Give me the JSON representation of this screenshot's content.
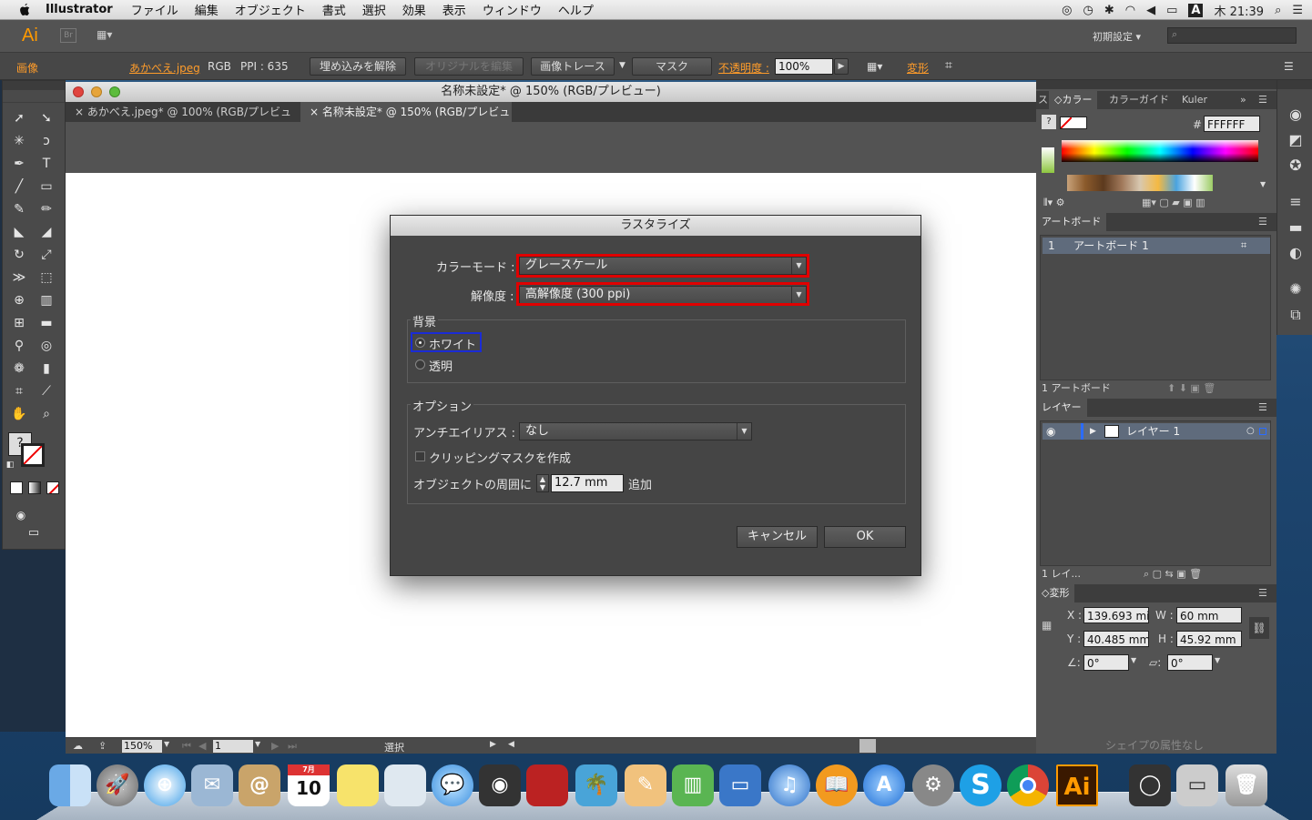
{
  "menubar": {
    "app_name": "Illustrator",
    "items": [
      "ファイル",
      "編集",
      "オブジェクト",
      "書式",
      "選択",
      "効果",
      "表示",
      "ウィンドウ",
      "ヘルプ"
    ],
    "clock": "木 21:39",
    "input_indicator": "A"
  },
  "appbar": {
    "logo": "Ai",
    "bridge": "Br",
    "workspace": "初期設定",
    "search_placeholder": ""
  },
  "control": {
    "mode": "画像",
    "filename": "あかべえ.jpeg",
    "colorspace": "RGB",
    "ppi": "PPI : 635",
    "unembed": "埋め込みを解除",
    "edit_original": "オリジナルを編集",
    "image_trace": "画像トレース",
    "mask": "マスク",
    "opacity_label": "不透明度 :",
    "opacity_value": "100%",
    "transform": "変形"
  },
  "document": {
    "title": "名称未設定* @ 150% (RGB/プレビュー)",
    "tabs": [
      {
        "label": "あかべえ.jpeg* @ 100% (RGB/プレビュー)",
        "active": false
      },
      {
        "label": "名称未設定* @ 150% (RGB/プレビュー)",
        "active": true
      }
    ],
    "zoom": "150%",
    "page": "1",
    "status_tool": "選択"
  },
  "dialog": {
    "title": "ラスタライズ",
    "color_mode_label": "カラーモード :",
    "color_mode_value": "グレースケール",
    "resolution_label": "解像度 :",
    "resolution_value": "高解像度 (300 ppi)",
    "background_group": "背景",
    "bg_white": "ホワイト",
    "bg_transparent": "透明",
    "bg_selected": "white",
    "options_group": "オプション",
    "antialias_label": "アンチエイリアス :",
    "antialias_value": "なし",
    "clipping_mask": "クリッピングマスクを作成",
    "clipping_checked": false,
    "padding_label": "オブジェクトの周囲に",
    "padding_value": "12.7 mm",
    "padding_suffix": "追加",
    "cancel": "キャンセル",
    "ok": "OK",
    "highlight_red": "#e00000",
    "highlight_blue": "#1a2bd6"
  },
  "color_panel": {
    "tabs": [
      "ス",
      "カラー",
      "カラーガイド",
      "Kuler"
    ],
    "hex_label": "#",
    "hex_value": "FFFFFF"
  },
  "artboard_panel": {
    "title": "アートボード",
    "rows": [
      {
        "num": "1",
        "name": "アートボード 1"
      }
    ],
    "footer": "1 アートボード"
  },
  "layers_panel": {
    "title": "レイヤー",
    "rows": [
      {
        "name": "レイヤー 1"
      }
    ],
    "footer": "1 レイ..."
  },
  "transform_panel": {
    "title": "変形",
    "x_label": "X :",
    "x": "139.693 mi",
    "y_label": "Y :",
    "y": "40.485 mm",
    "w_label": "W :",
    "w": "60 mm",
    "h_label": "H :",
    "h": "45.92 mm",
    "rotate": "0°",
    "shear": "0°",
    "shape_note": "シェイプの属性なし"
  },
  "dock": {
    "items": [
      "finder",
      "launchpad",
      "safari",
      "mail",
      "contacts",
      "calendar",
      "notes",
      "preview",
      "messages",
      "facetime",
      "photo-booth",
      "iphoto",
      "pages",
      "numbers",
      "keynote",
      "itunes",
      "ibooks",
      "app-store",
      "system-preferences",
      "skype",
      "chrome",
      "illustrator",
      "activity",
      "screenshot",
      "trash"
    ],
    "calendar_day": "10",
    "calendar_month": "7月",
    "illustrator_label": "Ai",
    "skype_label": "S"
  }
}
